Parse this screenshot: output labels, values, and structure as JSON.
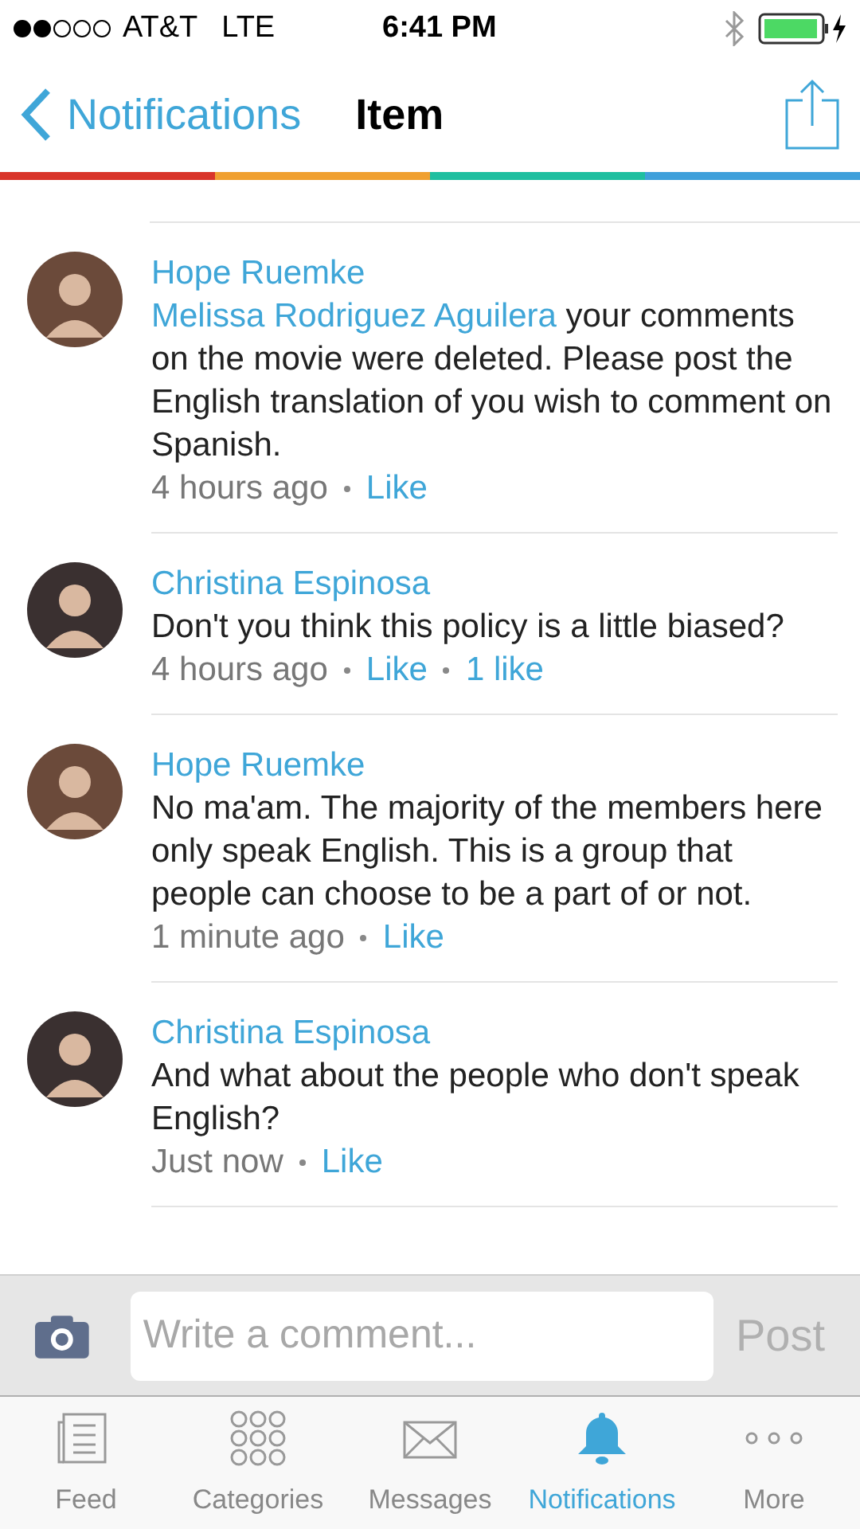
{
  "status_bar": {
    "carrier": "AT&T",
    "network": "LTE",
    "time": "6:41 PM"
  },
  "nav": {
    "back_label": "Notifications",
    "title": "Item"
  },
  "comments": [
    {
      "author": "Hope Ruemke",
      "mention": "Melissa Rodriguez Aguilera",
      "text": " your comments on the movie were deleted. Please post the English translation of you wish to comment on Spanish.",
      "time": "4 hours ago",
      "like": "Like"
    },
    {
      "author": "Christina Espinosa",
      "text": "Don't you think this policy is a little biased?",
      "time": "4 hours ago",
      "like": "Like",
      "like_count": "1 like"
    },
    {
      "author": "Hope Ruemke",
      "text": "No ma'am. The majority of the members here only speak English. This is a group that people can choose to be a part of or not.",
      "time": "1 minute ago",
      "like": "Like"
    },
    {
      "author": "Christina Espinosa",
      "text": "And what about the people who don't speak English?",
      "time": "Just now",
      "like": "Like"
    }
  ],
  "composer": {
    "placeholder": "Write a comment...",
    "post": "Post"
  },
  "tabs": [
    {
      "label": "Feed",
      "kind": "feed",
      "selected": false
    },
    {
      "label": "Categories",
      "kind": "grid",
      "selected": false
    },
    {
      "label": "Messages",
      "kind": "mail",
      "selected": false
    },
    {
      "label": "Notifications",
      "kind": "bell",
      "selected": true
    },
    {
      "label": "More",
      "kind": "more",
      "selected": false
    }
  ]
}
